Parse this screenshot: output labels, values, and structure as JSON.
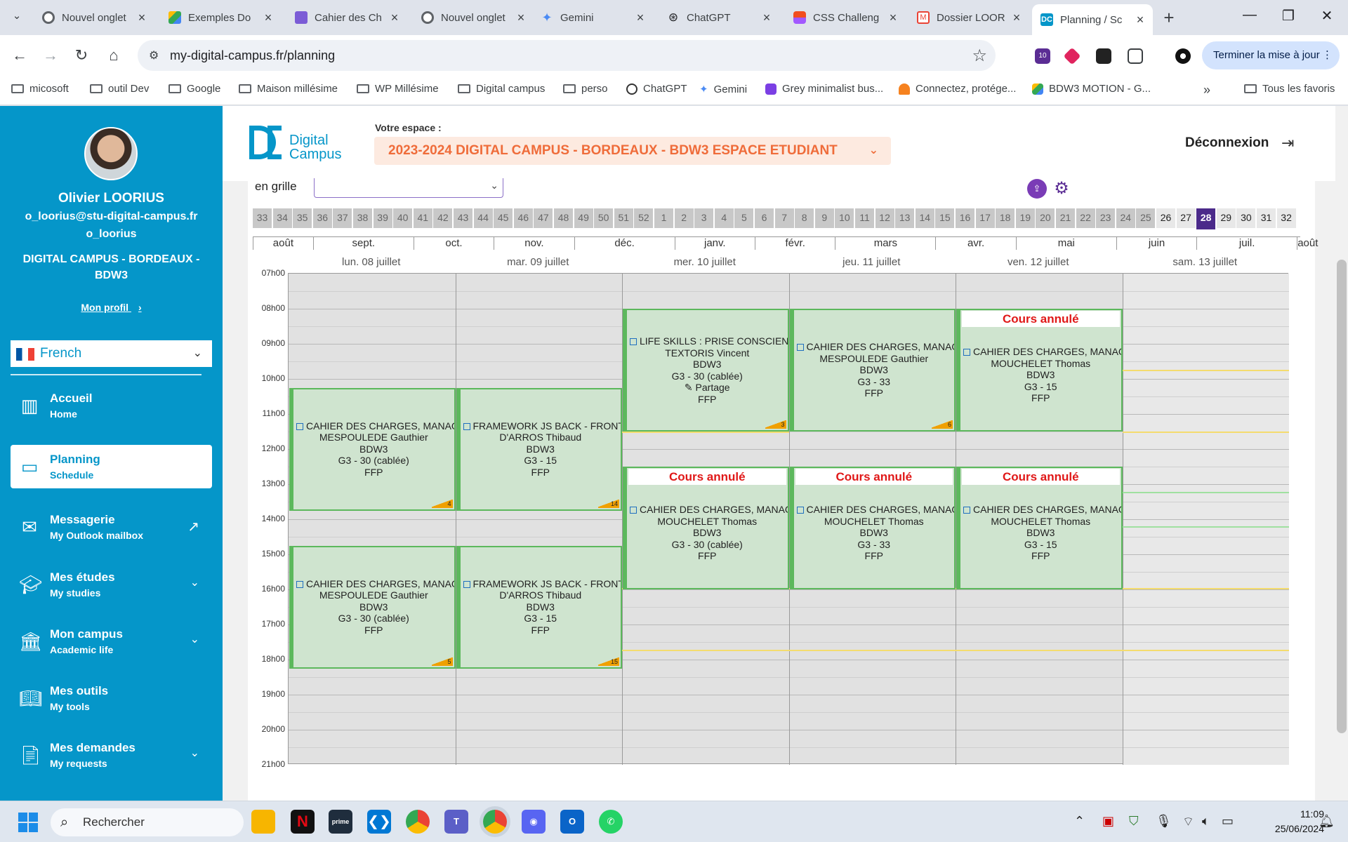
{
  "browser": {
    "tabs": [
      {
        "title": "Nouvel onglet",
        "color": "#4285f4"
      },
      {
        "title": "Exemples Do",
        "color": "#34a853"
      },
      {
        "title": "Cahier des Ch",
        "color": "#7b5cd6"
      },
      {
        "title": "Nouvel onglet",
        "color": "#4285f4"
      },
      {
        "title": "Gemini",
        "color": "#4a8af4"
      },
      {
        "title": "ChatGPT",
        "color": "#202124"
      },
      {
        "title": "CSS Challeng",
        "color": "#f24e1e"
      },
      {
        "title": "Dossier LOOR",
        "color": "#ea4335"
      },
      {
        "title": "Planning / Sc",
        "color": "#0596c9"
      }
    ],
    "url": "my-digital-campus.fr/planning",
    "update_button": "Terminer la mise à jour",
    "bookmarks": [
      "micosoft",
      "outil Dev",
      "Google",
      "Maison millésime",
      "WP Millésime",
      "Digital campus",
      "perso",
      "ChatGPT",
      "Gemini",
      "Grey minimalist bus...",
      "Connectez, protége...",
      "BDW3 MOTION - G..."
    ],
    "all_bookmarks": "Tous les favoris",
    "more_bookmarks": "»",
    "ext_badge": "10"
  },
  "sidebar": {
    "name": "Olivier LOORIUS",
    "email": "o_loorius@stu-digital-campus.fr",
    "login": "o_loorius",
    "school": "DIGITAL CAMPUS - BORDEAUX - BDW3",
    "profile_link": "Mon profil",
    "language": "French",
    "menu": [
      {
        "label": "Accueil",
        "sub": "Home"
      },
      {
        "label": "Planning",
        "sub": "Schedule"
      },
      {
        "label": "Messagerie",
        "sub": "My Outlook mailbox"
      },
      {
        "label": "Mes études",
        "sub": "My studies"
      },
      {
        "label": "Mon campus",
        "sub": "Academic life"
      },
      {
        "label": "Mes outils",
        "sub": "My tools"
      },
      {
        "label": "Mes demandes",
        "sub": "My requests"
      }
    ]
  },
  "header": {
    "logo_line1": "Digital",
    "logo_line2": "Campus",
    "space_label": "Votre espace :",
    "space_value": "2023-2024 DIGITAL CAMPUS - BORDEAUX - BDW3 ESPACE ETUDIANT",
    "logout": "Déconnexion",
    "accent": "#0596c9",
    "space_color": "#ef6c3a"
  },
  "planning": {
    "view_label": "en grille",
    "weeks": [
      "33",
      "34",
      "35",
      "36",
      "37",
      "38",
      "39",
      "40",
      "41",
      "42",
      "43",
      "44",
      "45",
      "46",
      "47",
      "48",
      "49",
      "50",
      "51",
      "52",
      "1",
      "2",
      "3",
      "4",
      "5",
      "6",
      "7",
      "8",
      "9",
      "10",
      "11",
      "12",
      "13",
      "14",
      "15",
      "16",
      "17",
      "18",
      "19",
      "20",
      "21",
      "22",
      "23",
      "24",
      "25",
      "26",
      "27",
      "28",
      "29",
      "30",
      "31",
      "32"
    ],
    "current_week": "28",
    "months": [
      "août",
      "sept.",
      "oct.",
      "nov.",
      "déc.",
      "janv.",
      "févr.",
      "mars",
      "avr.",
      "mai",
      "juin",
      "juil.",
      "août"
    ],
    "days": [
      "lun. 08 juillet",
      "mar. 09 juillet",
      "mer. 10 juillet",
      "jeu. 11 juillet",
      "ven. 12 juillet",
      "sam. 13 juillet"
    ],
    "hours": [
      "07h00",
      "08h00",
      "09h00",
      "10h00",
      "11h00",
      "12h00",
      "13h00",
      "14h00",
      "15h00",
      "16h00",
      "17h00",
      "18h00",
      "19h00",
      "20h00",
      "21h00"
    ],
    "cancel_label": "Cours annulé",
    "events": [
      {
        "course": "CAHIER DES CHARGES, MANAGEMENT",
        "teacher": "MESPOULEDE Gauthier",
        "group": "BDW3",
        "room": "G3 - 30 (cablée)",
        "funding": "FFP",
        "badge": "4",
        "share": "",
        "cancelled": false
      },
      {
        "course": "FRAMEWORK JS BACK - FRONT",
        "teacher": "D'ARROS Thibaud",
        "group": "BDW3",
        "room": "G3 - 15",
        "funding": "FFP",
        "badge": "14",
        "share": "",
        "cancelled": false
      },
      {
        "course": "LIFE SKILLS : PRISE CONSCIENCE",
        "teacher": "TEXTORIS Vincent",
        "group": "BDW3",
        "room": "G3 - 30 (cablée)",
        "funding": "FFP",
        "badge": "3",
        "share": "Partage",
        "cancelled": false
      },
      {
        "course": "CAHIER DES CHARGES, MANAGEMENT",
        "teacher": "MESPOULEDE Gauthier",
        "group": "BDW3",
        "room": "G3 - 33",
        "funding": "FFP",
        "badge": "6",
        "share": "",
        "cancelled": false
      },
      {
        "course": "CAHIER DES CHARGES, MANAGEMENT",
        "teacher": "MOUCHELET Thomas",
        "group": "BDW3",
        "room": "G3 - 15",
        "funding": "FFP",
        "badge": "",
        "share": "",
        "cancelled": true
      },
      {
        "course": "CAHIER DES CHARGES, MANAGEMENT",
        "teacher": "MESPOULEDE Gauthier",
        "group": "BDW3",
        "room": "G3 - 30 (cablée)",
        "funding": "FFP",
        "badge": "5",
        "share": "",
        "cancelled": false
      },
      {
        "course": "FRAMEWORK JS BACK - FRONT",
        "teacher": "D'ARROS Thibaud",
        "group": "BDW3",
        "room": "G3 - 15",
        "funding": "FFP",
        "badge": "15",
        "share": "",
        "cancelled": false
      },
      {
        "course": "CAHIER DES CHARGES, MANAGEMENT",
        "teacher": "MOUCHELET Thomas",
        "group": "BDW3",
        "room": "G3 - 30 (cablée)",
        "funding": "FFP",
        "badge": "",
        "share": "",
        "cancelled": true
      },
      {
        "course": "CAHIER DES CHARGES, MANAGEMENT",
        "teacher": "MOUCHELET Thomas",
        "group": "BDW3",
        "room": "G3 - 33",
        "funding": "FFP",
        "badge": "",
        "share": "",
        "cancelled": true
      },
      {
        "course": "CAHIER DES CHARGES, MANAGEMENT",
        "teacher": "MOUCHELET Thomas",
        "group": "BDW3",
        "room": "G3 - 15",
        "funding": "FFP",
        "badge": "",
        "share": "",
        "cancelled": true
      }
    ]
  },
  "taskbar": {
    "search": "Rechercher",
    "time": "11:09",
    "date": "25/06/2024"
  }
}
